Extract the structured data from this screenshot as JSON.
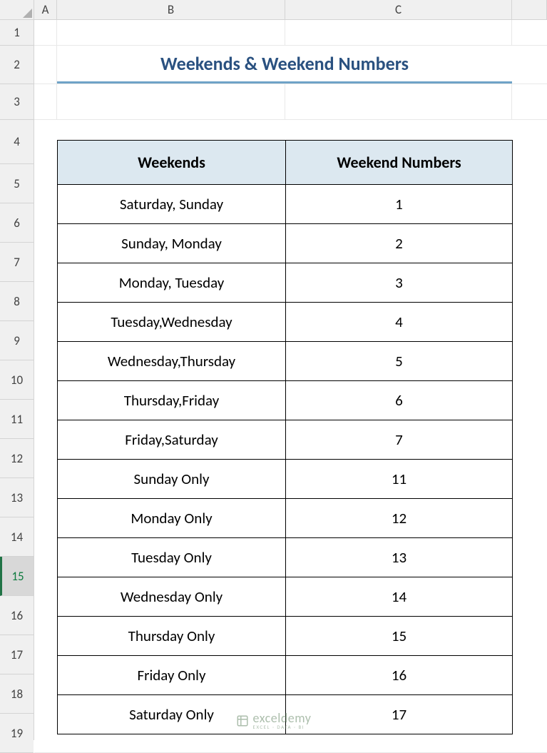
{
  "columns": [
    "A",
    "B",
    "C"
  ],
  "rows": [
    1,
    2,
    3,
    4,
    5,
    6,
    7,
    8,
    9,
    10,
    11,
    12,
    13,
    14,
    15,
    16,
    17,
    18,
    19
  ],
  "selectedRow": 15,
  "title": "Weekends & Weekend Numbers",
  "table": {
    "headers": [
      "Weekends",
      "Weekend Numbers"
    ],
    "rows": [
      {
        "weekends": "Saturday, Sunday",
        "number": "1"
      },
      {
        "weekends": "Sunday, Monday",
        "number": "2"
      },
      {
        "weekends": "Monday, Tuesday",
        "number": "3"
      },
      {
        "weekends": "Tuesday,Wednesday",
        "number": "4"
      },
      {
        "weekends": "Wednesday,Thursday",
        "number": "5"
      },
      {
        "weekends": "Thursday,Friday",
        "number": "6"
      },
      {
        "weekends": "Friday,Saturday",
        "number": "7"
      },
      {
        "weekends": "Sunday Only",
        "number": "11"
      },
      {
        "weekends": "Monday Only",
        "number": "12"
      },
      {
        "weekends": "Tuesday Only",
        "number": "13"
      },
      {
        "weekends": "Wednesday Only",
        "number": "14"
      },
      {
        "weekends": "Thursday Only",
        "number": "15"
      },
      {
        "weekends": "Friday Only",
        "number": "16"
      },
      {
        "weekends": "Saturday Only",
        "number": "17"
      }
    ]
  },
  "rowHeights": {
    "1": 36,
    "2": 54,
    "3": 50,
    "4": 62,
    "default": 55
  },
  "watermark": {
    "main": "exceldemy",
    "sub": "EXCEL · DATA · BI"
  }
}
